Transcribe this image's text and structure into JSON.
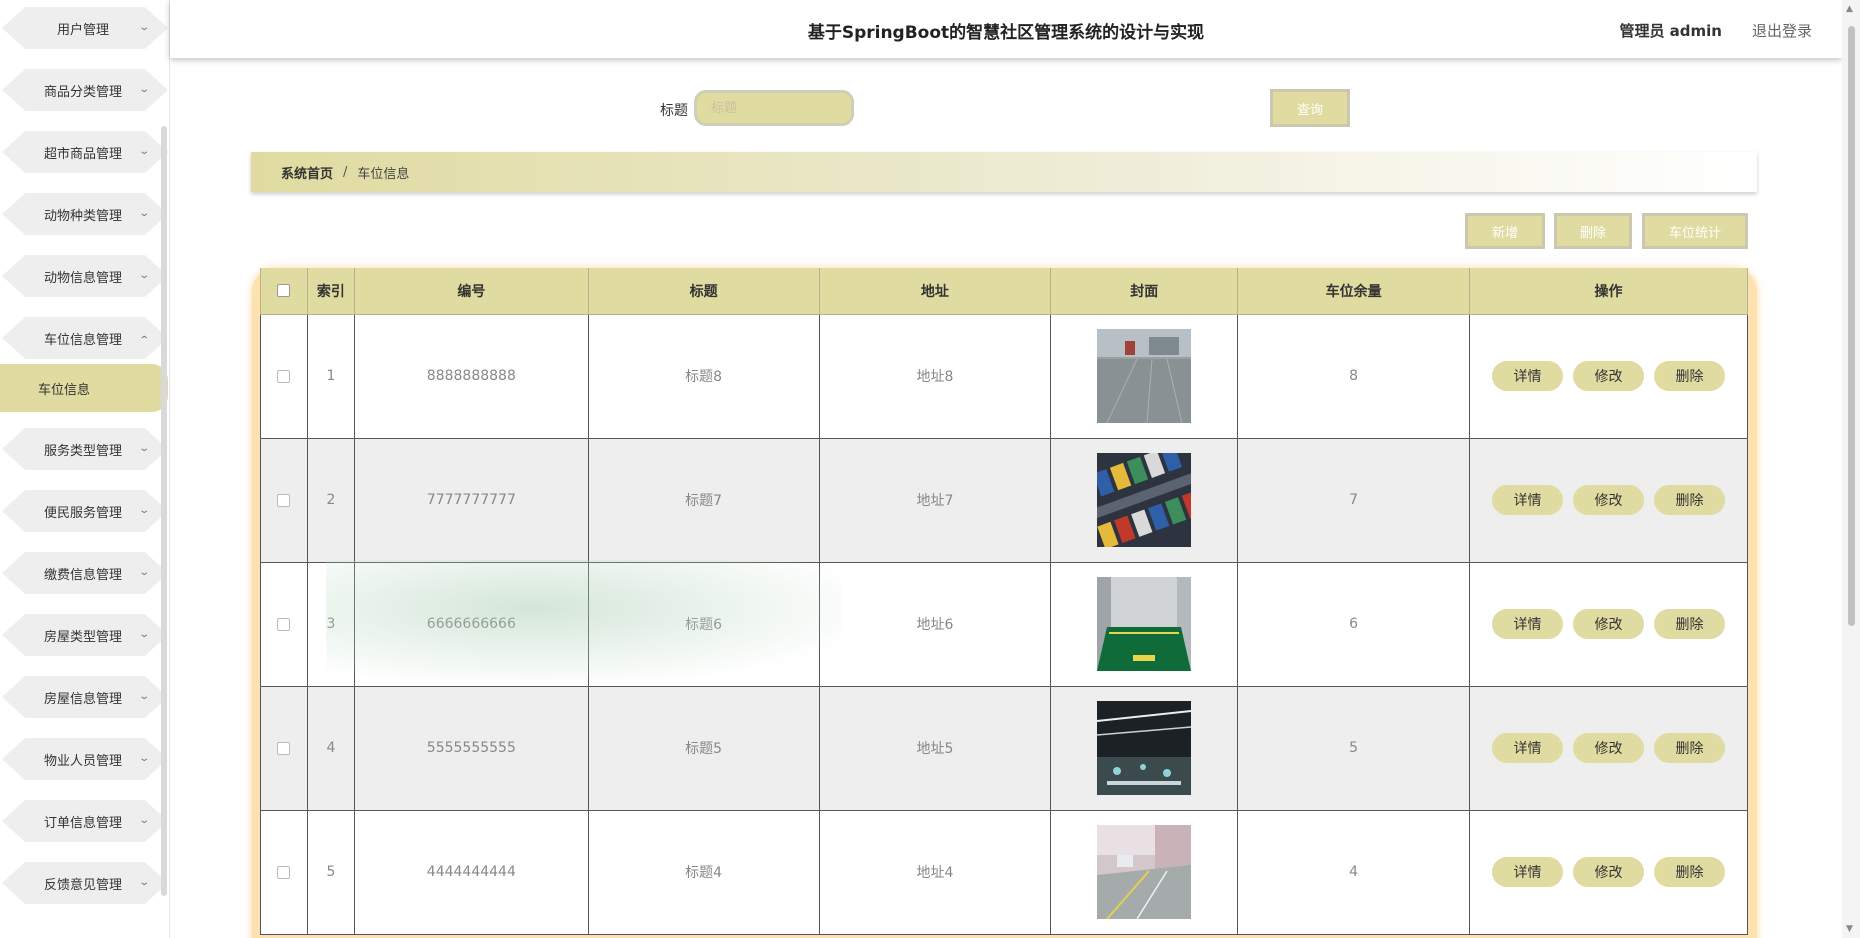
{
  "header": {
    "title": "基于SpringBoot的智慧社区管理系统的设计与实现",
    "user": "管理员 admin",
    "logout": "退出登录"
  },
  "sidebar": {
    "items": [
      {
        "label": "用户管理"
      },
      {
        "label": "商品分类管理"
      },
      {
        "label": "超市商品管理"
      },
      {
        "label": "动物种类管理"
      },
      {
        "label": "动物信息管理"
      },
      {
        "label": "车位信息管理"
      },
      {
        "label": "服务类型管理"
      },
      {
        "label": "便民服务管理"
      },
      {
        "label": "缴费信息管理"
      },
      {
        "label": "房屋类型管理"
      },
      {
        "label": "房屋信息管理"
      },
      {
        "label": "物业人员管理"
      },
      {
        "label": "订单信息管理"
      },
      {
        "label": "反馈意见管理"
      }
    ],
    "active_sub": "车位信息"
  },
  "search": {
    "label": "标题",
    "placeholder": "标题",
    "button": "查询"
  },
  "breadcrumb": {
    "home": "系统首页",
    "separator": "/",
    "current": "车位信息"
  },
  "actions": {
    "add": "新增",
    "delete": "删除",
    "stats": "车位统计"
  },
  "table": {
    "headers": [
      "索引",
      "编号",
      "标题",
      "地址",
      "封面",
      "车位余量",
      "操作"
    ],
    "rows": [
      {
        "index": "1",
        "code": "8888888888",
        "title": "标题8",
        "address": "地址8",
        "remaining": "8"
      },
      {
        "index": "2",
        "code": "7777777777",
        "title": "标题7",
        "address": "地址7",
        "remaining": "7"
      },
      {
        "index": "3",
        "code": "6666666666",
        "title": "标题6",
        "address": "地址6",
        "remaining": "6"
      },
      {
        "index": "4",
        "code": "5555555555",
        "title": "标题5",
        "address": "地址5",
        "remaining": "5"
      },
      {
        "index": "5",
        "code": "4444444444",
        "title": "标题4",
        "address": "地址4",
        "remaining": "4"
      }
    ],
    "row_actions": {
      "detail": "详情",
      "edit": "修改",
      "delete": "删除"
    }
  },
  "colors": {
    "accent": "#e0dba0",
    "table_border_glow": "#fde2b0",
    "sidebar_item": "#eeeeee"
  }
}
